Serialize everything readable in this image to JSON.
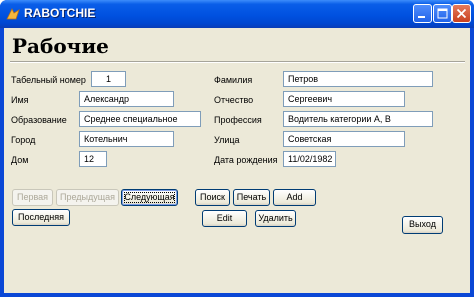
{
  "window": {
    "title": "RABOTCHIE",
    "icon": "app-icon"
  },
  "heading": "Рабочие",
  "form": {
    "tab_number": {
      "label": "Табельный номер",
      "value": "1"
    },
    "first_name": {
      "label": "Имя",
      "value": "Александр"
    },
    "education": {
      "label": "Образование",
      "value": "Среднее специальное"
    },
    "city": {
      "label": "Город",
      "value": "Котельнич"
    },
    "house": {
      "label": "Дом",
      "value": "12"
    },
    "last_name": {
      "label": "Фамилия",
      "value": "Петров"
    },
    "patronymic": {
      "label": "Отчество",
      "value": "Сергеевич"
    },
    "profession": {
      "label": "Профессия",
      "value": "Водитель категории А, В"
    },
    "street": {
      "label": "Улица",
      "value": "Советская"
    },
    "birth_date": {
      "label": "Дата рождения",
      "value": "11/02/1982"
    }
  },
  "buttons": {
    "first": "Первая",
    "previous": "Предыдущая",
    "next": "Следующая",
    "last": "Последняя",
    "search": "Поиск",
    "print": "Печать",
    "add": "Add",
    "edit": "Edit",
    "delete": "Удалить",
    "exit": "Выход"
  },
  "colors": {
    "titlebar": "#0054e3",
    "client": "#ece9d8",
    "field_border": "#7f9db9"
  }
}
